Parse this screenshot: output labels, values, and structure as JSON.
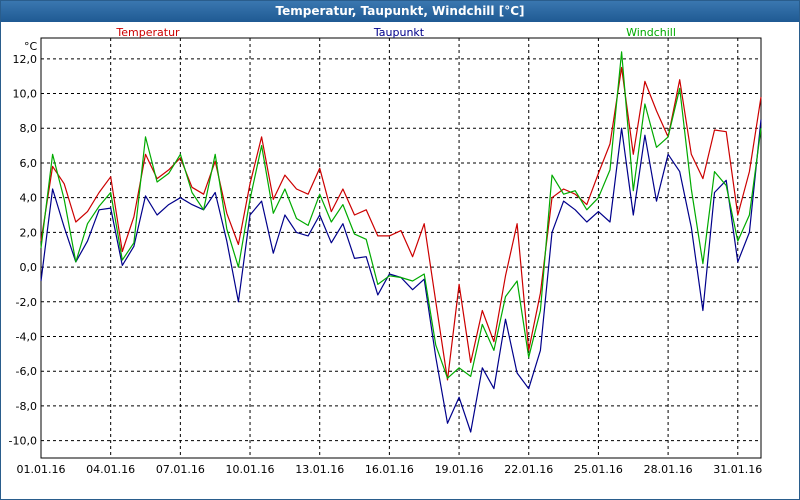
{
  "window": {
    "title": "Temperatur, Taupunkt, Windchill [°C]"
  },
  "chart_data": {
    "type": "line",
    "title": "Temperatur, Taupunkt, Windchill [°C]",
    "ylabel": "°C",
    "xlabel": "",
    "ylim": [
      -11,
      13.2
    ],
    "grid": true,
    "legend": "top",
    "x_start": "01.01.16",
    "x_end": "01.02.16",
    "x_ticks": [
      "01.01.16",
      "04.01.16",
      "07.01.16",
      "10.01.16",
      "13.01.16",
      "16.01.16",
      "19.01.16",
      "22.01.16",
      "25.01.16",
      "28.01.16",
      "31.01.16"
    ],
    "y_ticks": [
      "12,0",
      "10,0",
      "8,0",
      "6,0",
      "4,0",
      "2,0",
      "0,0",
      "-2,0",
      "-4,0",
      "-6,0",
      "-8,0",
      "-10,0"
    ],
    "x": [
      "01.01.16",
      "01.01.16 12h",
      "02.01.16",
      "02.01.16 12h",
      "03.01.16",
      "03.01.16 12h",
      "04.01.16",
      "04.01.16 12h",
      "05.01.16",
      "05.01.16 12h",
      "06.01.16",
      "06.01.16 12h",
      "07.01.16",
      "07.01.16 12h",
      "08.01.16",
      "08.01.16 12h",
      "09.01.16",
      "09.01.16 12h",
      "10.01.16",
      "10.01.16 12h",
      "11.01.16",
      "11.01.16 12h",
      "12.01.16",
      "12.01.16 12h",
      "13.01.16",
      "13.01.16 12h",
      "14.01.16",
      "14.01.16 12h",
      "15.01.16",
      "15.01.16 12h",
      "16.01.16",
      "16.01.16 12h",
      "17.01.16",
      "17.01.16 12h",
      "18.01.16",
      "18.01.16 12h",
      "19.01.16",
      "19.01.16 12h",
      "20.01.16",
      "20.01.16 12h",
      "21.01.16",
      "21.01.16 12h",
      "22.01.16",
      "22.01.16 12h",
      "23.01.16",
      "23.01.16 12h",
      "24.01.16",
      "24.01.16 12h",
      "25.01.16",
      "25.01.16 12h",
      "26.01.16",
      "26.01.16 12h",
      "27.01.16",
      "27.01.16 12h",
      "28.01.16",
      "28.01.16 12h",
      "29.01.16",
      "29.01.16 12h",
      "30.01.16",
      "30.01.16 12h",
      "31.01.16",
      "31.01.16 12h",
      "01.02.16"
    ],
    "series": [
      {
        "name": "Temperatur",
        "color": "#cc0000",
        "values": [
          1.5,
          5.8,
          4.8,
          2.6,
          3.2,
          4.3,
          5.2,
          0.9,
          2.9,
          6.5,
          5.1,
          5.6,
          6.3,
          4.6,
          4.2,
          6.1,
          3.1,
          1.3,
          4.8,
          7.5,
          3.9,
          5.3,
          4.5,
          4.2,
          5.7,
          3.2,
          4.5,
          3.0,
          3.3,
          1.8,
          1.8,
          2.1,
          0.6,
          2.5,
          -2.0,
          -6.5,
          -1.0,
          -5.5,
          -2.5,
          -4.3,
          -0.5,
          2.5,
          -4.8,
          -1.5,
          4.0,
          4.5,
          4.2,
          3.6,
          5.4,
          7.1,
          11.5,
          6.5,
          10.7,
          9.0,
          7.5,
          10.8,
          6.5,
          5.1,
          7.9,
          7.8,
          3.0,
          5.5,
          9.8
        ]
      },
      {
        "name": "Taupunkt",
        "color": "#00008b",
        "values": [
          -0.8,
          4.5,
          2.3,
          0.3,
          1.5,
          3.3,
          3.4,
          0.1,
          1.2,
          4.1,
          3.0,
          3.6,
          4.0,
          3.6,
          3.3,
          4.3,
          1.5,
          -2.0,
          3.0,
          3.8,
          0.8,
          3.0,
          2.0,
          1.8,
          3.0,
          1.4,
          2.5,
          0.5,
          0.6,
          -1.6,
          -0.4,
          -0.6,
          -1.3,
          -0.7,
          -5.2,
          -9.0,
          -7.5,
          -9.5,
          -5.8,
          -7.0,
          -3.0,
          -6.1,
          -7.0,
          -4.8,
          2.0,
          3.8,
          3.3,
          2.6,
          3.2,
          2.6,
          8.0,
          3.0,
          7.6,
          3.8,
          6.5,
          5.5,
          2.3,
          -2.5,
          4.3,
          5.0,
          0.3,
          2.0,
          8.5
        ]
      },
      {
        "name": "Windchill",
        "color": "#00aa00",
        "values": [
          1.1,
          6.5,
          3.9,
          0.3,
          2.5,
          3.5,
          4.3,
          0.4,
          1.4,
          7.5,
          4.9,
          5.4,
          6.5,
          4.3,
          3.3,
          6.5,
          2.2,
          0.0,
          3.9,
          7.0,
          3.1,
          4.5,
          2.8,
          2.4,
          4.2,
          2.6,
          3.6,
          1.9,
          1.6,
          -1.0,
          -0.5,
          -0.6,
          -0.8,
          -0.4,
          -4.5,
          -6.4,
          -5.8,
          -6.3,
          -3.3,
          -4.8,
          -1.7,
          -0.8,
          -5.2,
          -2.5,
          5.3,
          4.2,
          4.4,
          3.3,
          4.0,
          5.6,
          12.4,
          4.4,
          9.4,
          6.9,
          7.5,
          10.3,
          4.5,
          0.2,
          5.5,
          4.7,
          1.5,
          3.0,
          8.0
        ]
      }
    ]
  }
}
